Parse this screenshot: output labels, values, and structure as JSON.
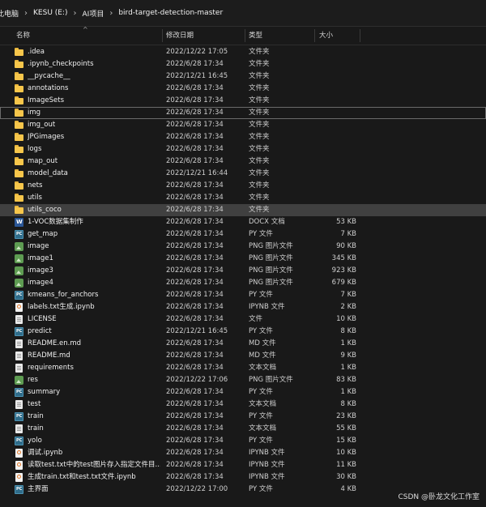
{
  "breadcrumb": {
    "items": [
      "此电脑",
      "KESU (E:)",
      "AI项目",
      "bird-target-detection-master"
    ],
    "separator": "›"
  },
  "columns": {
    "name": "名称",
    "date": "修改日期",
    "type": "类型",
    "size": "大小"
  },
  "files": [
    {
      "name": ".idea",
      "date": "2022/12/22 17:05",
      "type": "文件夹",
      "size": "",
      "icon": "folder"
    },
    {
      "name": ".ipynb_checkpoints",
      "date": "2022/6/28 17:34",
      "type": "文件夹",
      "size": "",
      "icon": "folder"
    },
    {
      "name": "__pycache__",
      "date": "2022/12/21 16:45",
      "type": "文件夹",
      "size": "",
      "icon": "folder"
    },
    {
      "name": "annotations",
      "date": "2022/6/28 17:34",
      "type": "文件夹",
      "size": "",
      "icon": "folder"
    },
    {
      "name": "ImageSets",
      "date": "2022/6/28 17:34",
      "type": "文件夹",
      "size": "",
      "icon": "folder"
    },
    {
      "name": "img",
      "date": "2022/6/28 17:34",
      "type": "文件夹",
      "size": "",
      "icon": "folder",
      "state": "outlined"
    },
    {
      "name": "img_out",
      "date": "2022/6/28 17:34",
      "type": "文件夹",
      "size": "",
      "icon": "folder"
    },
    {
      "name": "JPGimages",
      "date": "2022/6/28 17:34",
      "type": "文件夹",
      "size": "",
      "icon": "folder"
    },
    {
      "name": "logs",
      "date": "2022/6/28 17:34",
      "type": "文件夹",
      "size": "",
      "icon": "folder"
    },
    {
      "name": "map_out",
      "date": "2022/6/28 17:34",
      "type": "文件夹",
      "size": "",
      "icon": "folder"
    },
    {
      "name": "model_data",
      "date": "2022/12/21 16:44",
      "type": "文件夹",
      "size": "",
      "icon": "folder"
    },
    {
      "name": "nets",
      "date": "2022/6/28 17:34",
      "type": "文件夹",
      "size": "",
      "icon": "folder"
    },
    {
      "name": "utils",
      "date": "2022/6/28 17:34",
      "type": "文件夹",
      "size": "",
      "icon": "folder"
    },
    {
      "name": "utils_coco",
      "date": "2022/6/28 17:34",
      "type": "文件夹",
      "size": "",
      "icon": "folder",
      "state": "selected"
    },
    {
      "name": "1-VOC数据集制作",
      "date": "2022/6/28 17:34",
      "type": "DOCX 文档",
      "size": "53 KB",
      "icon": "docx"
    },
    {
      "name": "get_map",
      "date": "2022/6/28 17:34",
      "type": "PY 文件",
      "size": "7 KB",
      "icon": "py"
    },
    {
      "name": "image",
      "date": "2022/6/28 17:34",
      "type": "PNG 图片文件",
      "size": "90 KB",
      "icon": "image"
    },
    {
      "name": "image1",
      "date": "2022/6/28 17:34",
      "type": "PNG 图片文件",
      "size": "345 KB",
      "icon": "image"
    },
    {
      "name": "image3",
      "date": "2022/6/28 17:34",
      "type": "PNG 图片文件",
      "size": "923 KB",
      "icon": "image"
    },
    {
      "name": "image4",
      "date": "2022/6/28 17:34",
      "type": "PNG 图片文件",
      "size": "679 KB",
      "icon": "image"
    },
    {
      "name": "kmeans_for_anchors",
      "date": "2022/6/28 17:34",
      "type": "PY 文件",
      "size": "7 KB",
      "icon": "py"
    },
    {
      "name": "labels.txt生成.ipynb",
      "date": "2022/6/28 17:34",
      "type": "IPYNB 文件",
      "size": "2 KB",
      "icon": "ipynb"
    },
    {
      "name": "LICENSE",
      "date": "2022/6/28 17:34",
      "type": "文件",
      "size": "10 KB",
      "icon": "file"
    },
    {
      "name": "predict",
      "date": "2022/12/21 16:45",
      "type": "PY 文件",
      "size": "8 KB",
      "icon": "py"
    },
    {
      "name": "README.en.md",
      "date": "2022/6/28 17:34",
      "type": "MD 文件",
      "size": "1 KB",
      "icon": "file"
    },
    {
      "name": "README.md",
      "date": "2022/6/28 17:34",
      "type": "MD 文件",
      "size": "9 KB",
      "icon": "file"
    },
    {
      "name": "requirements",
      "date": "2022/6/28 17:34",
      "type": "文本文档",
      "size": "1 KB",
      "icon": "file"
    },
    {
      "name": "res",
      "date": "2022/12/22 17:06",
      "type": "PNG 图片文件",
      "size": "83 KB",
      "icon": "image"
    },
    {
      "name": "summary",
      "date": "2022/6/28 17:34",
      "type": "PY 文件",
      "size": "1 KB",
      "icon": "py"
    },
    {
      "name": "test",
      "date": "2022/6/28 17:34",
      "type": "文本文档",
      "size": "8 KB",
      "icon": "file"
    },
    {
      "name": "train",
      "date": "2022/6/28 17:34",
      "type": "PY 文件",
      "size": "23 KB",
      "icon": "py"
    },
    {
      "name": "train",
      "date": "2022/6/28 17:34",
      "type": "文本文档",
      "size": "55 KB",
      "icon": "file"
    },
    {
      "name": "yolo",
      "date": "2022/6/28 17:34",
      "type": "PY 文件",
      "size": "15 KB",
      "icon": "py"
    },
    {
      "name": "调试.ipynb",
      "date": "2022/6/28 17:34",
      "type": "IPYNB 文件",
      "size": "10 KB",
      "icon": "ipynb"
    },
    {
      "name": "读取test.txt中的test图片存入指定文件目...",
      "date": "2022/6/28 17:34",
      "type": "IPYNB 文件",
      "size": "11 KB",
      "icon": "ipynb"
    },
    {
      "name": "生成train.txt和test.txt文件.ipynb",
      "date": "2022/6/28 17:34",
      "type": "IPYNB 文件",
      "size": "30 KB",
      "icon": "ipynb"
    },
    {
      "name": "主界面",
      "date": "2022/12/22 17:00",
      "type": "PY 文件",
      "size": "4 KB",
      "icon": "py"
    }
  ],
  "watermark": "CSDN @卧龙文化工作室"
}
